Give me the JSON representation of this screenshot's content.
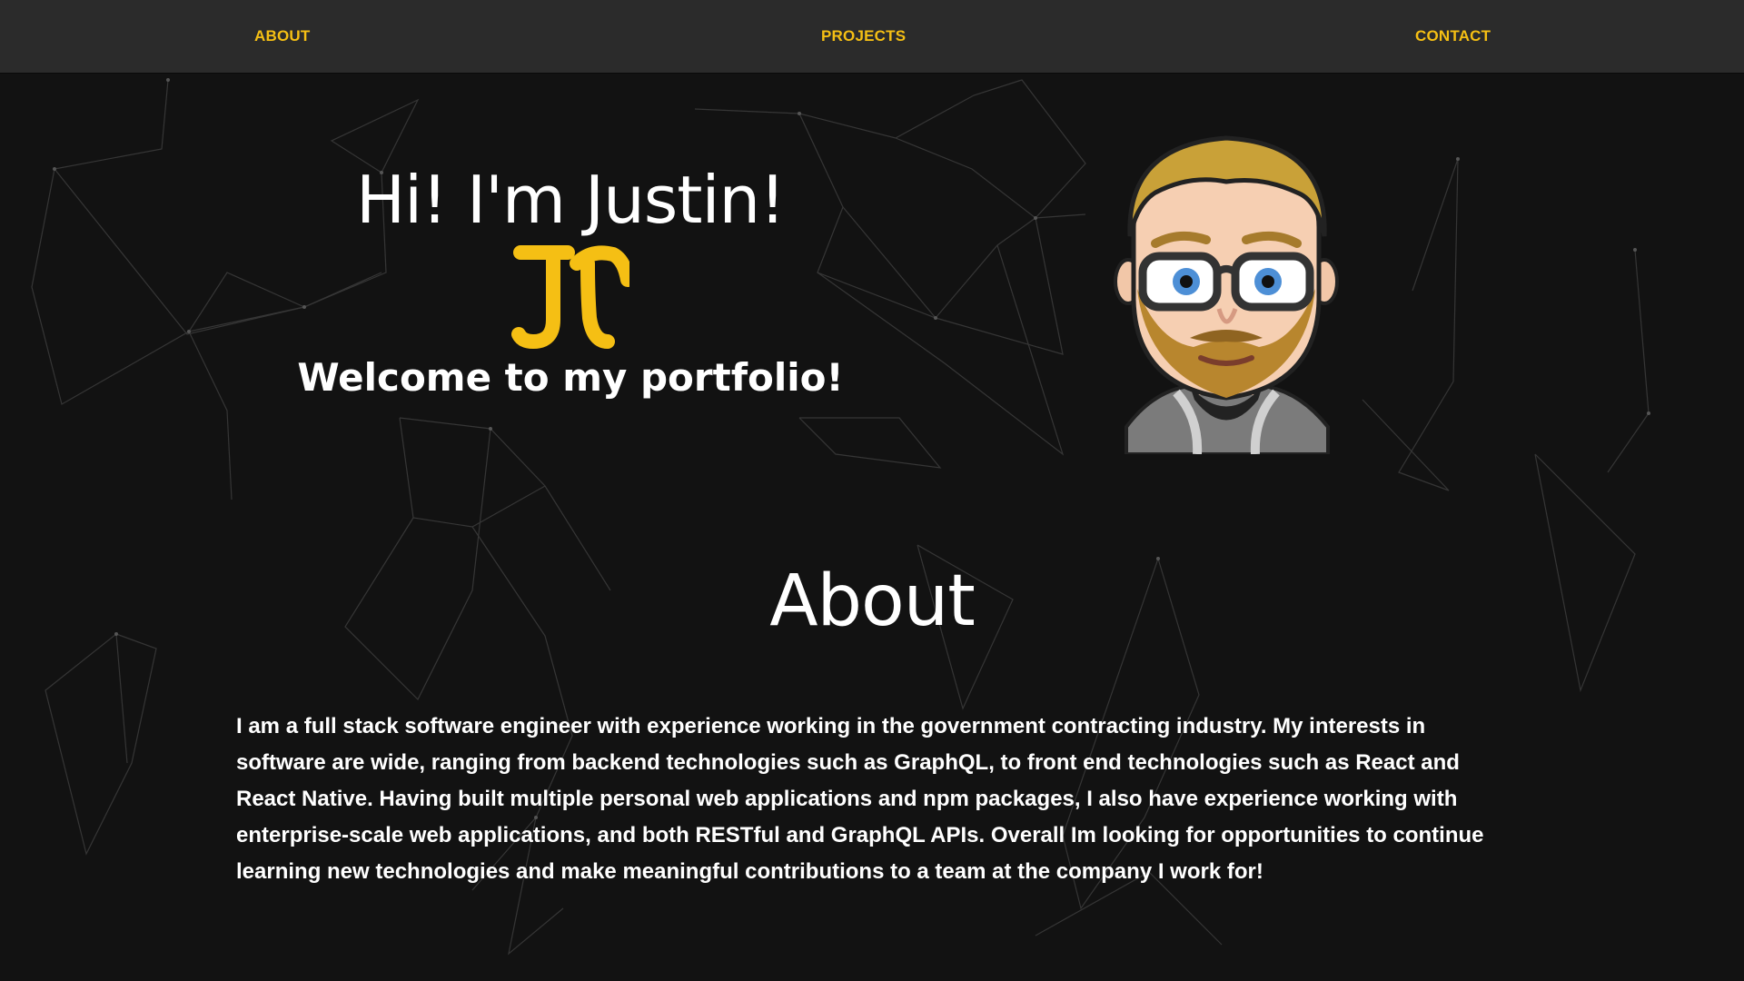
{
  "nav": {
    "about": "ABOUT",
    "projects": "PROJECTS",
    "contact": "CONTACT"
  },
  "hero": {
    "greeting": "Hi! I'm Justin!",
    "logo_text": "JT",
    "welcome": "Welcome to my portfolio!"
  },
  "about": {
    "title": "About",
    "body": "I am a full stack software engineer with experience working in the government contracting industry. My interests in software are wide, ranging from backend technologies such as GraphQL, to front end technologies such as React and React Native. Having built multiple personal web applications and npm packages, I also have experience working with enterprise-scale web applications, and both RESTful and GraphQL APIs. Overall Im looking for opportunities to continue learning new technologies and make meaningful contributions to a team at the company I work for!"
  },
  "colors": {
    "accent": "#f5bf14",
    "navbar_bg": "#2b2b2b",
    "page_bg": "#121212",
    "text": "#ffffff"
  },
  "icons": {
    "logo": "jt-monogram-logo",
    "avatar": "bitmoji-avatar",
    "background": "particle-network-background"
  }
}
